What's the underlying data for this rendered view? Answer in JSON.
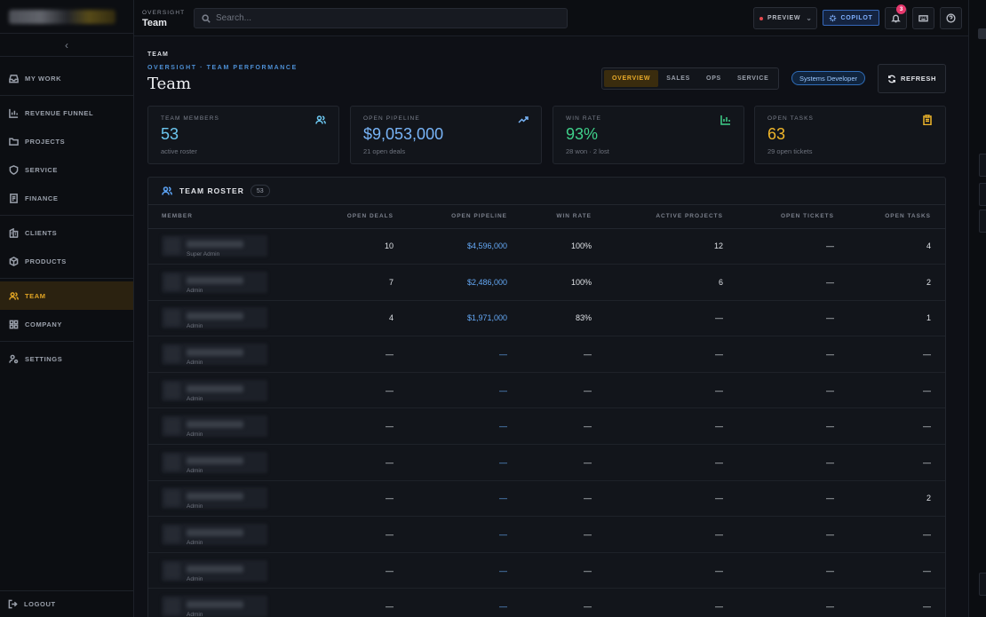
{
  "sidebar": {
    "collapse_label": "‹",
    "items": [
      {
        "label": "MY WORK",
        "icon": "inbox-icon",
        "active": false
      },
      {
        "label": "REVENUE FUNNEL",
        "icon": "bar-chart-icon",
        "active": false
      },
      {
        "label": "PROJECTS",
        "icon": "folder-icon",
        "active": false
      },
      {
        "label": "SERVICE",
        "icon": "shield-icon",
        "active": false
      },
      {
        "label": "FINANCE",
        "icon": "ledger-icon",
        "active": false
      },
      {
        "label": "CLIENTS",
        "icon": "building-icon",
        "active": false
      },
      {
        "label": "PRODUCTS",
        "icon": "box-icon",
        "active": false
      },
      {
        "label": "TEAM",
        "icon": "users-icon",
        "active": true
      },
      {
        "label": "COMPANY",
        "icon": "grid-icon",
        "active": false
      },
      {
        "label": "SETTINGS",
        "icon": "user-gear-icon",
        "active": false
      }
    ],
    "logout_label": "LOGOUT"
  },
  "topbar": {
    "section": "OVERSIGHT",
    "title": "Team",
    "search_placeholder": "Search...",
    "preview_label": "PREVIEW",
    "copilot_label": "COPILOT",
    "notification_count": "3"
  },
  "page": {
    "crumb": "TEAM",
    "subtitle": "OVERSIGHT · TEAM PERFORMANCE",
    "title": "Team",
    "tabs": [
      {
        "label": "OVERVIEW",
        "active": true
      },
      {
        "label": "SALES",
        "active": false
      },
      {
        "label": "OPS",
        "active": false
      },
      {
        "label": "SERVICE",
        "active": false
      }
    ],
    "role_pill": "Systems Developer",
    "refresh_label": "REFRESH"
  },
  "stats": [
    {
      "label": "TEAM MEMBERS",
      "value": "53",
      "sub": "active roster",
      "color": "#6cc7f0",
      "icon": "users-icon"
    },
    {
      "label": "OPEN PIPELINE",
      "value": "$9,053,000",
      "sub": "21 open deals",
      "color": "#78b4f7",
      "icon": "trending-up-icon"
    },
    {
      "label": "WIN RATE",
      "value": "93%",
      "sub": "28 won · 2 lost",
      "color": "#3fd08a",
      "icon": "bar-chart-icon"
    },
    {
      "label": "OPEN TASKS",
      "value": "63",
      "sub": "29 open tickets",
      "color": "#f0b62a",
      "icon": "clipboard-icon"
    }
  ],
  "roster": {
    "title": "TEAM ROSTER",
    "count": "53",
    "columns": [
      "MEMBER",
      "OPEN DEALS",
      "OPEN PIPELINE",
      "WIN RATE",
      "ACTIVE PROJECTS",
      "OPEN TICKETS",
      "OPEN TASKS"
    ],
    "rows": [
      {
        "role": "Super Admin",
        "deals": "10",
        "pipeline": "$4,596,000",
        "win": "100%",
        "projects": "12",
        "tickets": "—",
        "tasks": "4"
      },
      {
        "role": "Admin",
        "deals": "7",
        "pipeline": "$2,486,000",
        "win": "100%",
        "projects": "6",
        "tickets": "—",
        "tasks": "2"
      },
      {
        "role": "Admin",
        "deals": "4",
        "pipeline": "$1,971,000",
        "win": "83%",
        "projects": "—",
        "tickets": "—",
        "tasks": "1"
      },
      {
        "role": "Admin",
        "deals": "—",
        "pipeline": "—",
        "win": "—",
        "projects": "—",
        "tickets": "—",
        "tasks": "—"
      },
      {
        "role": "Admin",
        "deals": "—",
        "pipeline": "—",
        "win": "—",
        "projects": "—",
        "tickets": "—",
        "tasks": "—"
      },
      {
        "role": "Admin",
        "deals": "—",
        "pipeline": "—",
        "win": "—",
        "projects": "—",
        "tickets": "—",
        "tasks": "—"
      },
      {
        "role": "Admin",
        "deals": "—",
        "pipeline": "—",
        "win": "—",
        "projects": "—",
        "tickets": "—",
        "tasks": "—"
      },
      {
        "role": "Admin",
        "deals": "—",
        "pipeline": "—",
        "win": "—",
        "projects": "—",
        "tickets": "—",
        "tasks": "2"
      },
      {
        "role": "Admin",
        "deals": "—",
        "pipeline": "—",
        "win": "—",
        "projects": "—",
        "tickets": "—",
        "tasks": "—"
      },
      {
        "role": "Admin",
        "deals": "—",
        "pipeline": "—",
        "win": "—",
        "projects": "—",
        "tickets": "—",
        "tasks": "—"
      },
      {
        "role": "Admin",
        "deals": "—",
        "pipeline": "—",
        "win": "—",
        "projects": "—",
        "tickets": "—",
        "tasks": "—"
      }
    ]
  }
}
